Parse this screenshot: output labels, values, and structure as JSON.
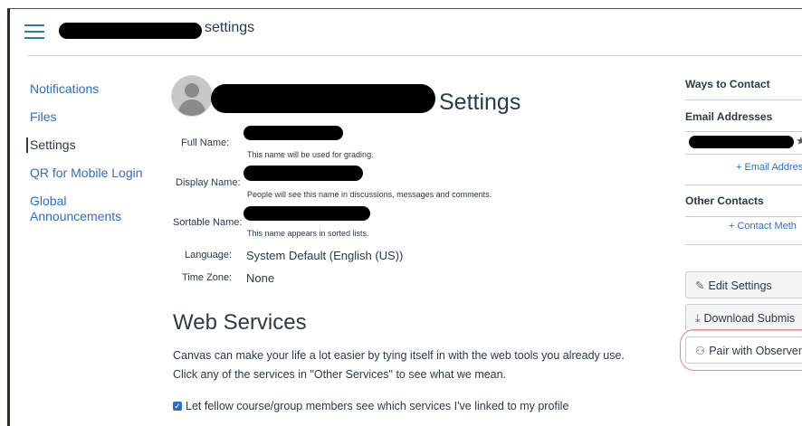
{
  "header": {
    "title_suffix": "settings"
  },
  "nav": {
    "items": [
      {
        "label": "Notifications"
      },
      {
        "label": "Files"
      },
      {
        "label": "Settings"
      },
      {
        "label": "QR for Mobile Login"
      },
      {
        "label": "Global Announcements"
      }
    ]
  },
  "profile": {
    "title_suffix": "Settings",
    "fields": {
      "full_name": {
        "label": "Full Name:",
        "hint": "This name will be used for grading."
      },
      "display_name": {
        "label": "Display Name:",
        "hint": "People will see this name in discussions, messages and comments."
      },
      "sortable_name": {
        "label": "Sortable Name:",
        "hint": "This name appears in sorted lists."
      },
      "language": {
        "label": "Language:",
        "value": "System Default (English (US))"
      },
      "time_zone": {
        "label": "Time Zone:",
        "value": "None"
      }
    }
  },
  "web_services": {
    "title": "Web Services",
    "line1": "Canvas can make your life a lot easier by tying itself in with the web tools you already use.",
    "line2": "Click any of the services in \"Other Services\" to see what we mean.",
    "checkbox_label": "Let fellow course/group members see which services I've linked to my profile",
    "checkbox_checked": true
  },
  "sidebar": {
    "ways_to_contact": "Ways to Contact",
    "email_addresses": "Email Addresses",
    "add_email": "Email Addres",
    "other_contacts": "Other Contacts",
    "add_contact": "Contact Meth",
    "buttons": {
      "edit_settings": "Edit Settings",
      "download_submissions": "Download Submis",
      "pair_with_observer": "Pair with Observer"
    }
  },
  "colors": {
    "link": "#2d6ec8",
    "text": "#2d3b45",
    "annotation": "#e48a8a"
  }
}
